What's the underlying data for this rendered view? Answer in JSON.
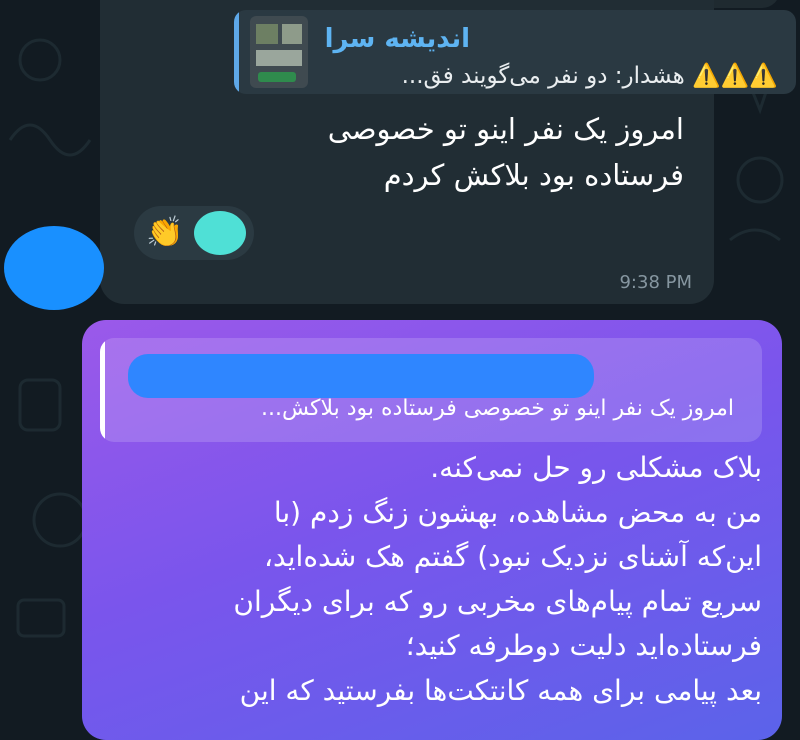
{
  "incoming_message": {
    "reply": {
      "sender_name": "اندیشه سرا",
      "warning_icons": "⚠️⚠️⚠️",
      "snippet": "هشدار: دو نفر می‌گویند فق..."
    },
    "text": "امروز یک نفر اینو تو خصوصی فرستاده بود بلاکش کردم",
    "reaction": {
      "emoji": "👏",
      "icon": "clapping-hands-icon"
    },
    "time": "9:38 PM"
  },
  "outgoing_message": {
    "reply": {
      "snippet": "امروز یک نفر اینو تو خصوصی فرستاده بود بلاکش..."
    },
    "lines": [
      "بلاک مشکلی رو حل نمی‌کنه.",
      "من به محض مشاهده، بهشون زنگ زدم (با",
      "این‌که آشنای نزدیک نبود) گفتم هک شده‌اید،",
      "سریع تمام پیام‌های مخربی رو که برای دیگران",
      "فرستاده‌اید دلیت دوطرفه کنید؛",
      "بعد پیامی برای همه کانتکت‌ها بفرستید که این"
    ]
  },
  "colors": {
    "chat_background": "#121b22",
    "incoming_bubble": "#212d34",
    "reply_accent": "#5eb4f2",
    "outgoing_gradient_start": "#9b59ea",
    "outgoing_gradient_end": "#5b63ea",
    "redaction_blue": "#2f86ff",
    "avatar_blue": "#1990ff",
    "reaction_avatar": "#4fe0d6"
  }
}
